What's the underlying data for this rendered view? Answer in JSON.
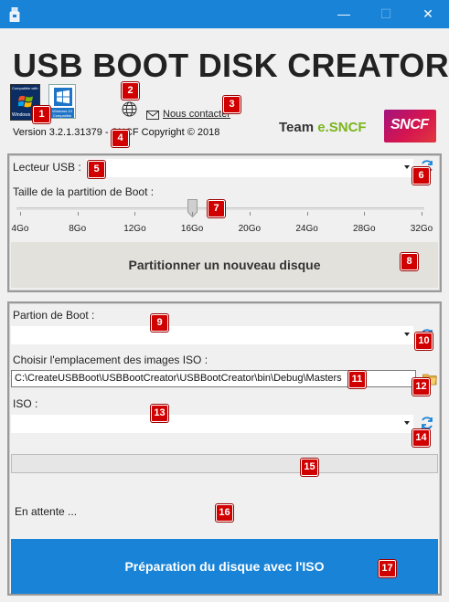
{
  "window": {
    "min_glyph": "—",
    "max_glyph": "☐",
    "close_glyph": "✕"
  },
  "header": {
    "title": "USB BOOT DISK CREATOR",
    "win7_badge_top": "Compatible with",
    "win7_badge_bottom": "Windows",
    "win10_badge": "Windows 10 Compatible",
    "contact_label": "Nous contacter",
    "version": "Version 3.2.1.31379 - SNCF Copyright ©  2018",
    "team_prefix": "Team ",
    "team_brand": "e.SNCF",
    "sncf_logo_text": "SNCF"
  },
  "partition_panel": {
    "usb_label": "Lecteur USB :",
    "usb_value": "",
    "size_label": "Taille de la partition de Boot :",
    "slider": {
      "ticks": [
        "4Go",
        "8Go",
        "12Go",
        "16Go",
        "20Go",
        "24Go",
        "28Go",
        "32Go"
      ],
      "selected": "16Go",
      "value_gb": 16,
      "min_gb": 4,
      "max_gb": 32
    },
    "partition_button": "Partitionner un nouveau disque"
  },
  "iso_panel": {
    "boot_partition_label": "Partion de Boot :",
    "boot_partition_value": "",
    "iso_location_label": "Choisir l'emplacement des images ISO :",
    "iso_location_value": "C:\\CreateUSBBoot\\USBBootCreator\\USBBootCreator\\bin\\Debug\\Masters",
    "iso_label": "ISO :",
    "iso_value": "",
    "progress": 0,
    "status": "En attente ...",
    "prepare_button": "Préparation du disque avec l'ISO"
  },
  "badges": [
    "1",
    "2",
    "3",
    "4",
    "5",
    "6",
    "7",
    "8",
    "9",
    "10",
    "11",
    "12",
    "13",
    "14",
    "15",
    "16",
    "17"
  ],
  "colors": {
    "titlebar": "#1883d7",
    "primary_button": "#1883d7",
    "badge": "#d10000",
    "team_brand": "#7bb51c",
    "sncf_logo": "#c2185b"
  },
  "icons": [
    "app-icon",
    "globe-icon",
    "mail-icon",
    "refresh-icon",
    "folder-icon",
    "windows-flag-icon"
  ]
}
